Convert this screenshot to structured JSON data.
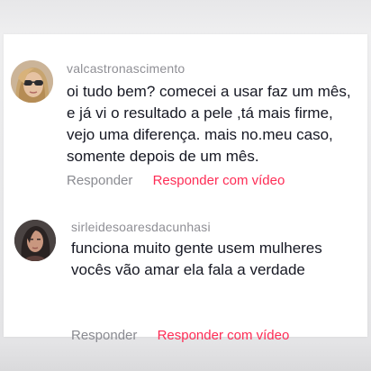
{
  "comments": [
    {
      "username": "valcastronascimento",
      "avatar_icon": "user-avatar-woman-sunglasses",
      "text_lines": [
        "oi tudo bem? comecei a usar faz um mês,",
        "e já vi o resultado a pele ,tá mais firme,",
        "vejo uma diferença. mais no.meu caso,",
        "somente depois de um mês."
      ],
      "reply_label": "Responder",
      "reply_video_label": "Responder com vídeo"
    },
    {
      "username": "sirleidesoaresdacunhasi",
      "avatar_icon": "user-avatar-woman",
      "text_lines": [
        "funciona muito gente usem mulheres",
        "vocês vão amar ela fala a verdade"
      ],
      "reply_label": "Responder",
      "reply_video_label": "Responder com vídeo"
    }
  ],
  "colors": {
    "text": "#161823",
    "username": "#8f8f95",
    "reply": "#8a8b91",
    "accent": "#fe2c55"
  }
}
